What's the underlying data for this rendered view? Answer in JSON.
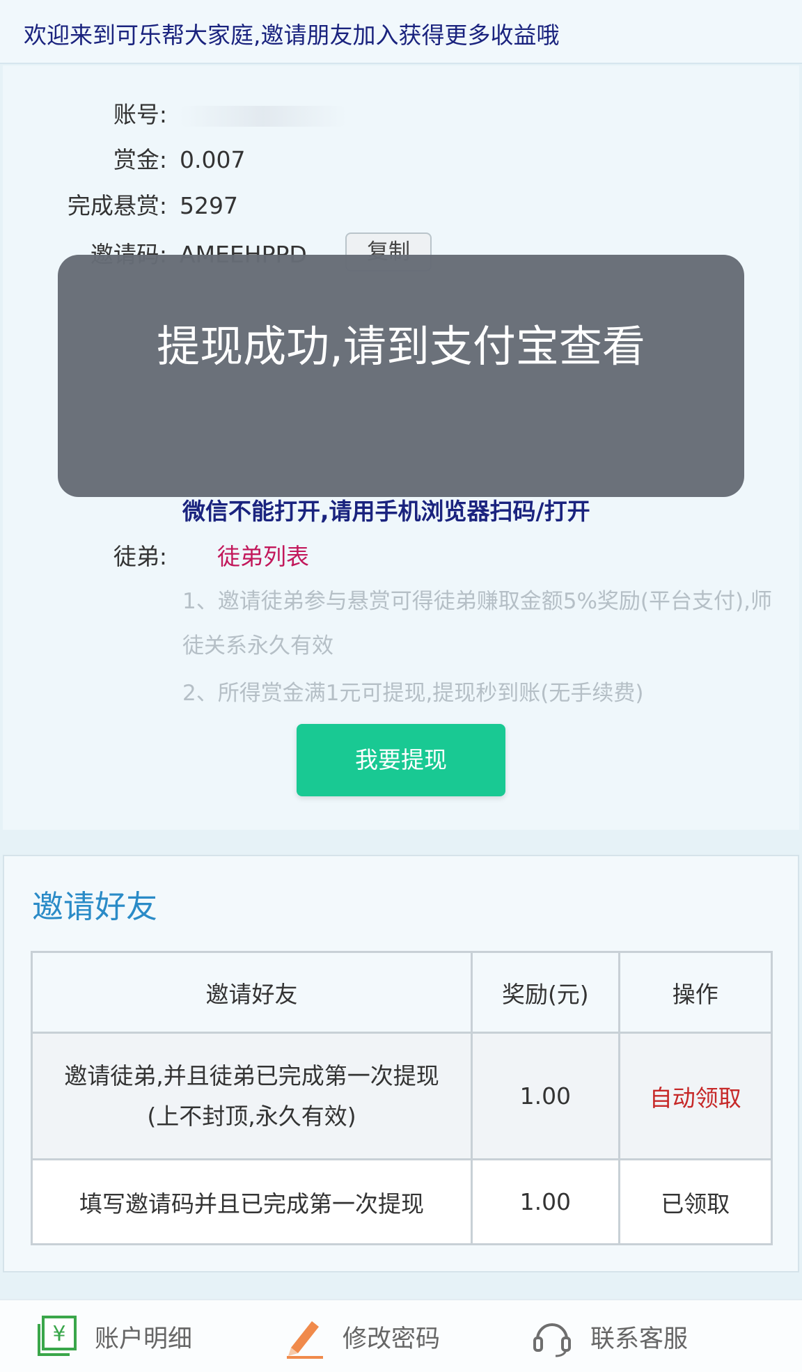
{
  "header": {
    "welcome": "欢迎来到可乐帮大家庭,邀请朋友加入获得更多收益哦"
  },
  "account": {
    "account_label": "账号:",
    "bounty_label": "赏金:",
    "bounty_value": "0.007",
    "completed_label": "完成悬赏:",
    "completed_value": "5297",
    "invite_label": "邀请码:",
    "invite_value": "AMEEHPPD",
    "copy_label": "复制",
    "wechat_notice": "微信不能打开,请用手机浏览器扫码/打开",
    "apprentice_label": "徒弟:",
    "apprentice_link": "徒弟列表",
    "notes": [
      "1、邀请徒弟参与悬赏可得徒弟赚取金额5%奖励(平台支付),师徒关系永久有效",
      "2、所得赏金满1元可提现,提现秒到账(无手续费)"
    ],
    "withdraw_button": "我要提现"
  },
  "toast": {
    "message": "提现成功,请到支付宝查看"
  },
  "invite": {
    "title": "邀请好友",
    "columns": [
      "邀请好友",
      "奖励(元)",
      "操作"
    ],
    "rows": [
      {
        "desc": "邀请徒弟,并且徒弟已完成第一次提现",
        "desc2": "(上不封顶,永久有效)",
        "reward": "1.00",
        "action": "自动领取"
      },
      {
        "desc": "填写邀请码并且已完成第一次提现",
        "desc2": "",
        "reward": "1.00",
        "action": "已领取"
      }
    ]
  },
  "footer": {
    "items": [
      {
        "label": "账户明细",
        "icon": "money-icon"
      },
      {
        "label": "修改密码",
        "icon": "pencil-icon"
      },
      {
        "label": "联系客服",
        "icon": "headset-icon"
      }
    ]
  },
  "colors": {
    "withdraw_button": "#19c993",
    "link": "#c2185b",
    "auto_claim": "#c62828",
    "notice": "#1a237e",
    "invite_title": "#2a8bc7"
  }
}
